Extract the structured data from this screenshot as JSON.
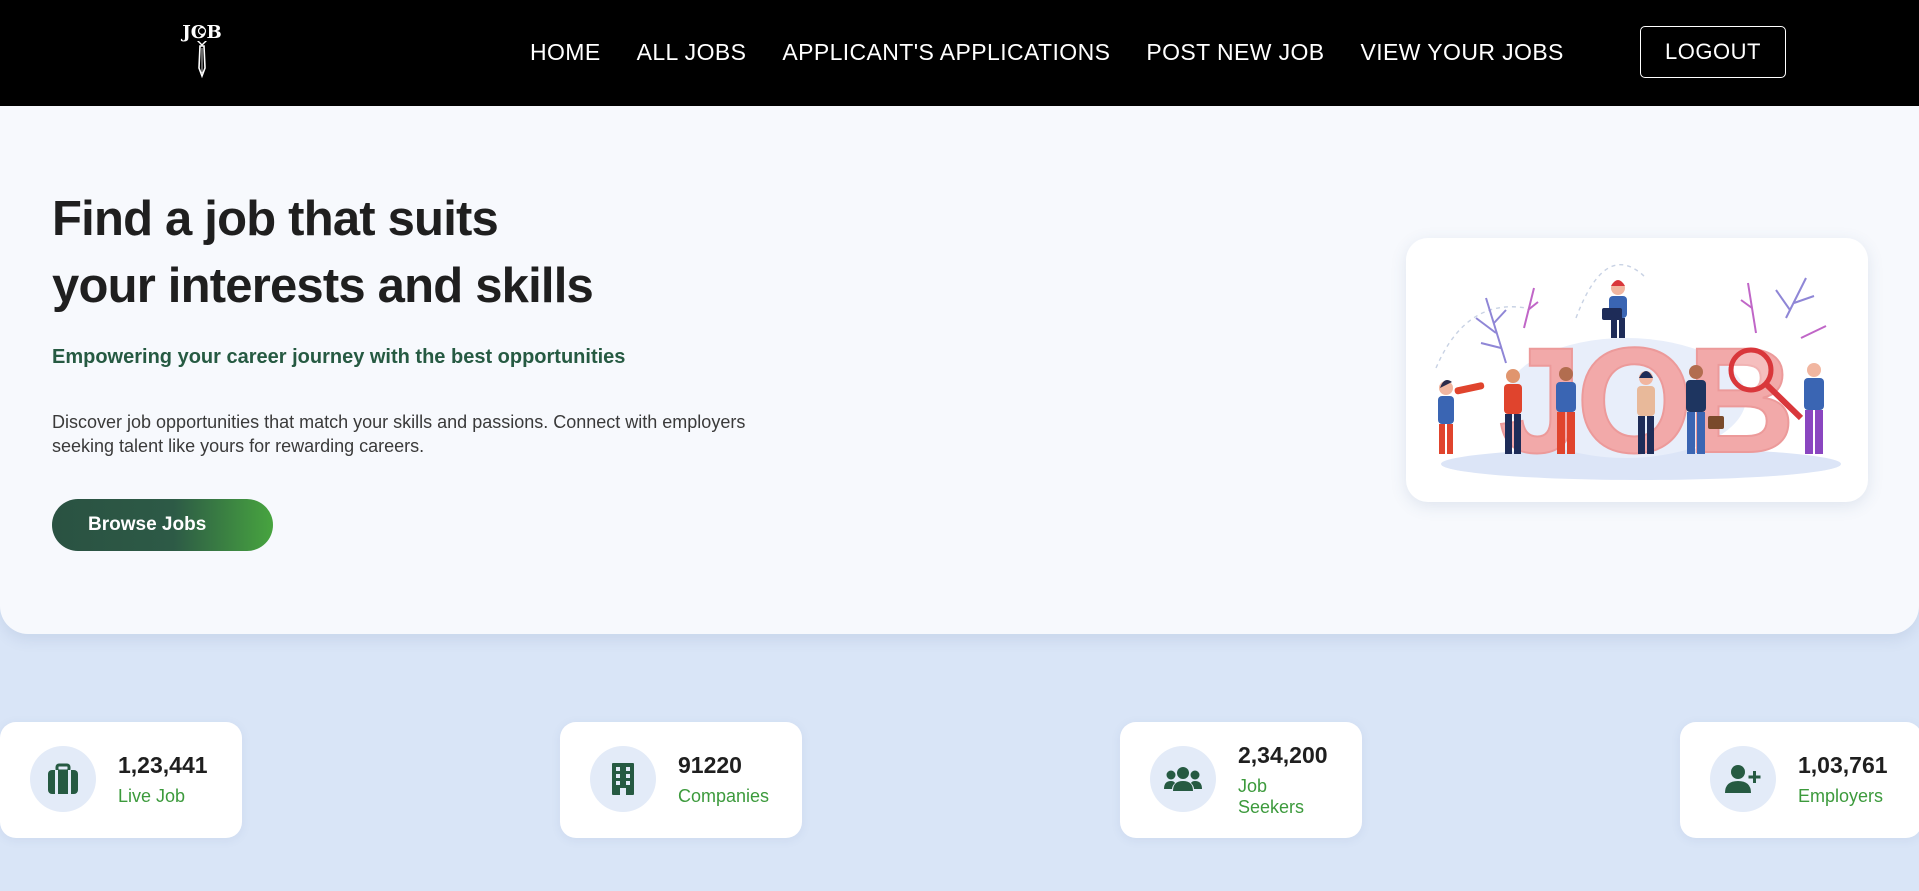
{
  "navbar": {
    "logo_text": "JOB",
    "links": [
      "HOME",
      "ALL JOBS",
      "APPLICANT'S APPLICATIONS",
      "POST NEW JOB",
      "VIEW YOUR JOBS"
    ],
    "logout_label": "LOGOUT"
  },
  "hero": {
    "title_line1": "Find a job that suits",
    "title_line2": "your interests and skills",
    "subtitle": "Empowering your career journey with the best opportunities",
    "description": "Discover job opportunities that match your skills and passions. Connect with employers seeking talent like yours for rewarding careers.",
    "browse_label": "Browse Jobs",
    "illustration_text": "JOB"
  },
  "stats": [
    {
      "value": "1,23,441",
      "label": "Live Job",
      "icon": "briefcase-icon"
    },
    {
      "value": "91220",
      "label": "Companies",
      "icon": "building-icon"
    },
    {
      "value": "2,34,200",
      "label": "Job Seekers",
      "icon": "users-icon"
    },
    {
      "value": "1,03,761",
      "label": "Employers",
      "icon": "user-plus-icon"
    }
  ],
  "colors": {
    "nav_bg": "#000000",
    "accent_green": "#265a42",
    "stat_label_green": "#3c9a3c",
    "page_bg": "#d9e5f7",
    "illustration_pink": "#f2a9a9"
  }
}
